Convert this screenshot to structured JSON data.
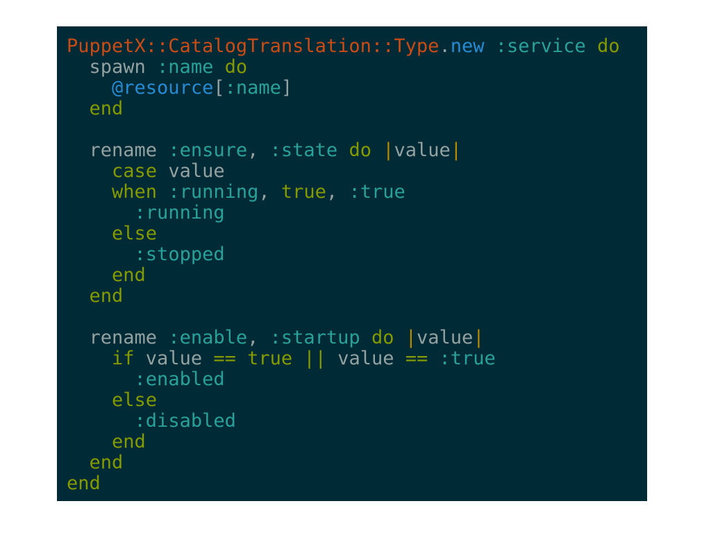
{
  "colors": {
    "background": "#002b36",
    "page": "#ffffff",
    "constant": "#cb4b16",
    "method": "#268bd2",
    "symbol": "#2aa198",
    "keyword": "#859900",
    "identifier": "#93a1a1",
    "instance_variable": "#268bd2",
    "pipe": "#b58900"
  },
  "lines": [
    [
      {
        "t": "PuppetX::CatalogTranslation::Type",
        "c": "const"
      },
      {
        "t": ".",
        "c": "punct"
      },
      {
        "t": "new",
        "c": "method"
      },
      {
        "t": " ",
        "c": "punct"
      },
      {
        "t": ":service",
        "c": "sym"
      },
      {
        "t": " ",
        "c": "punct"
      },
      {
        "t": "do",
        "c": "kw"
      }
    ],
    [
      {
        "t": "  spawn ",
        "c": "ident"
      },
      {
        "t": ":name",
        "c": "sym"
      },
      {
        "t": " ",
        "c": "punct"
      },
      {
        "t": "do",
        "c": "kw"
      }
    ],
    [
      {
        "t": "    ",
        "c": "punct"
      },
      {
        "t": "@resource",
        "c": "ivar"
      },
      {
        "t": "[",
        "c": "punct"
      },
      {
        "t": ":name",
        "c": "sym"
      },
      {
        "t": "]",
        "c": "punct"
      }
    ],
    [
      {
        "t": "  ",
        "c": "punct"
      },
      {
        "t": "end",
        "c": "kw"
      }
    ],
    [],
    [
      {
        "t": "  rename ",
        "c": "ident"
      },
      {
        "t": ":ensure",
        "c": "sym"
      },
      {
        "t": ", ",
        "c": "punct"
      },
      {
        "t": ":state",
        "c": "sym"
      },
      {
        "t": " ",
        "c": "punct"
      },
      {
        "t": "do",
        "c": "kw"
      },
      {
        "t": " ",
        "c": "punct"
      },
      {
        "t": "|",
        "c": "pipe"
      },
      {
        "t": "value",
        "c": "ident"
      },
      {
        "t": "|",
        "c": "pipe"
      }
    ],
    [
      {
        "t": "    ",
        "c": "punct"
      },
      {
        "t": "case",
        "c": "kw"
      },
      {
        "t": " value",
        "c": "ident"
      }
    ],
    [
      {
        "t": "    ",
        "c": "punct"
      },
      {
        "t": "when",
        "c": "kw"
      },
      {
        "t": " ",
        "c": "punct"
      },
      {
        "t": ":running",
        "c": "sym"
      },
      {
        "t": ", ",
        "c": "punct"
      },
      {
        "t": "true",
        "c": "kw"
      },
      {
        "t": ", ",
        "c": "punct"
      },
      {
        "t": ":true",
        "c": "sym"
      }
    ],
    [
      {
        "t": "      ",
        "c": "punct"
      },
      {
        "t": ":running",
        "c": "sym"
      }
    ],
    [
      {
        "t": "    ",
        "c": "punct"
      },
      {
        "t": "else",
        "c": "kw"
      }
    ],
    [
      {
        "t": "      ",
        "c": "punct"
      },
      {
        "t": ":stopped",
        "c": "sym"
      }
    ],
    [
      {
        "t": "    ",
        "c": "punct"
      },
      {
        "t": "end",
        "c": "kw"
      }
    ],
    [
      {
        "t": "  ",
        "c": "punct"
      },
      {
        "t": "end",
        "c": "kw"
      }
    ],
    [],
    [
      {
        "t": "  rename ",
        "c": "ident"
      },
      {
        "t": ":enable",
        "c": "sym"
      },
      {
        "t": ", ",
        "c": "punct"
      },
      {
        "t": ":startup",
        "c": "sym"
      },
      {
        "t": " ",
        "c": "punct"
      },
      {
        "t": "do",
        "c": "kw"
      },
      {
        "t": " ",
        "c": "punct"
      },
      {
        "t": "|",
        "c": "pipe"
      },
      {
        "t": "value",
        "c": "ident"
      },
      {
        "t": "|",
        "c": "pipe"
      }
    ],
    [
      {
        "t": "    ",
        "c": "punct"
      },
      {
        "t": "if",
        "c": "kw"
      },
      {
        "t": " value ",
        "c": "ident"
      },
      {
        "t": "==",
        "c": "kw"
      },
      {
        "t": " ",
        "c": "punct"
      },
      {
        "t": "true",
        "c": "kw"
      },
      {
        "t": " ",
        "c": "punct"
      },
      {
        "t": "||",
        "c": "kw"
      },
      {
        "t": " value ",
        "c": "ident"
      },
      {
        "t": "==",
        "c": "kw"
      },
      {
        "t": " ",
        "c": "punct"
      },
      {
        "t": ":true",
        "c": "sym"
      }
    ],
    [
      {
        "t": "      ",
        "c": "punct"
      },
      {
        "t": ":enabled",
        "c": "sym"
      }
    ],
    [
      {
        "t": "    ",
        "c": "punct"
      },
      {
        "t": "else",
        "c": "kw"
      }
    ],
    [
      {
        "t": "      ",
        "c": "punct"
      },
      {
        "t": ":disabled",
        "c": "sym"
      }
    ],
    [
      {
        "t": "    ",
        "c": "punct"
      },
      {
        "t": "end",
        "c": "kw"
      }
    ],
    [
      {
        "t": "  ",
        "c": "punct"
      },
      {
        "t": "end",
        "c": "kw"
      }
    ],
    [
      {
        "t": "end",
        "c": "kw"
      }
    ]
  ]
}
